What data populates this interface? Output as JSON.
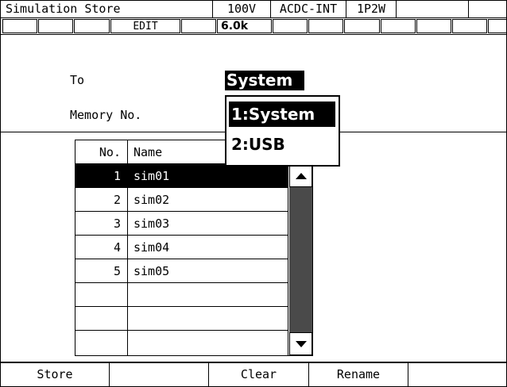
{
  "header": {
    "title": "Simulation Store",
    "voltage": "100V",
    "mode": "ACDC-INT",
    "wiring": "1P2W",
    "extra": ""
  },
  "status_bar": {
    "slots": [
      "",
      "",
      "EDIT",
      "",
      "6.0k",
      "",
      "",
      "",
      "",
      ""
    ]
  },
  "form": {
    "to_label": "To",
    "to_value": "System",
    "memory_label": "Memory No."
  },
  "dropdown": {
    "options": [
      "1:System",
      "2:USB"
    ],
    "selected_index": 0
  },
  "table": {
    "headers": [
      "No.",
      "Name"
    ],
    "rows": [
      {
        "no": "1",
        "name": "sim01"
      },
      {
        "no": "2",
        "name": "sim02"
      },
      {
        "no": "3",
        "name": "sim03"
      },
      {
        "no": "4",
        "name": "sim04"
      },
      {
        "no": "5",
        "name": "sim05"
      },
      {
        "no": "",
        "name": ""
      },
      {
        "no": "",
        "name": ""
      },
      {
        "no": "",
        "name": ""
      }
    ],
    "selected_index": 0
  },
  "softkeys": [
    "Store",
    "",
    "Clear",
    "Rename",
    ""
  ]
}
